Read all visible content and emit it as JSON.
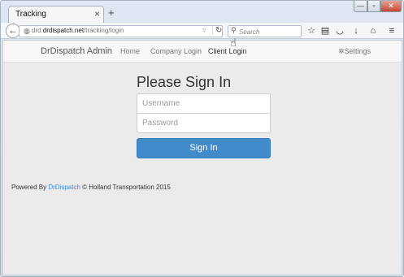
{
  "browser": {
    "tab_title": "Tracking",
    "tab_close": "×",
    "new_tab": "+",
    "url_prefix": "drd.",
    "url_host": "drdispatch.net",
    "url_path": "/tracking/login",
    "search_placeholder": "Search",
    "window_controls": {
      "minimize": "—",
      "maximize": "▫",
      "close": "✕"
    }
  },
  "site": {
    "brand": "DrDispatch Admin",
    "nav": [
      {
        "label": "Home"
      },
      {
        "label": "Company Login"
      },
      {
        "label": "Client Login"
      }
    ],
    "settings_label": "Settings"
  },
  "login": {
    "title": "Please Sign In",
    "username_placeholder": "Username",
    "password_placeholder": "Password",
    "submit_label": "Sign In"
  },
  "footer": {
    "prefix": "Powered By ",
    "link": "DrDispatch",
    "suffix": " © Holland Transportation 2015"
  }
}
